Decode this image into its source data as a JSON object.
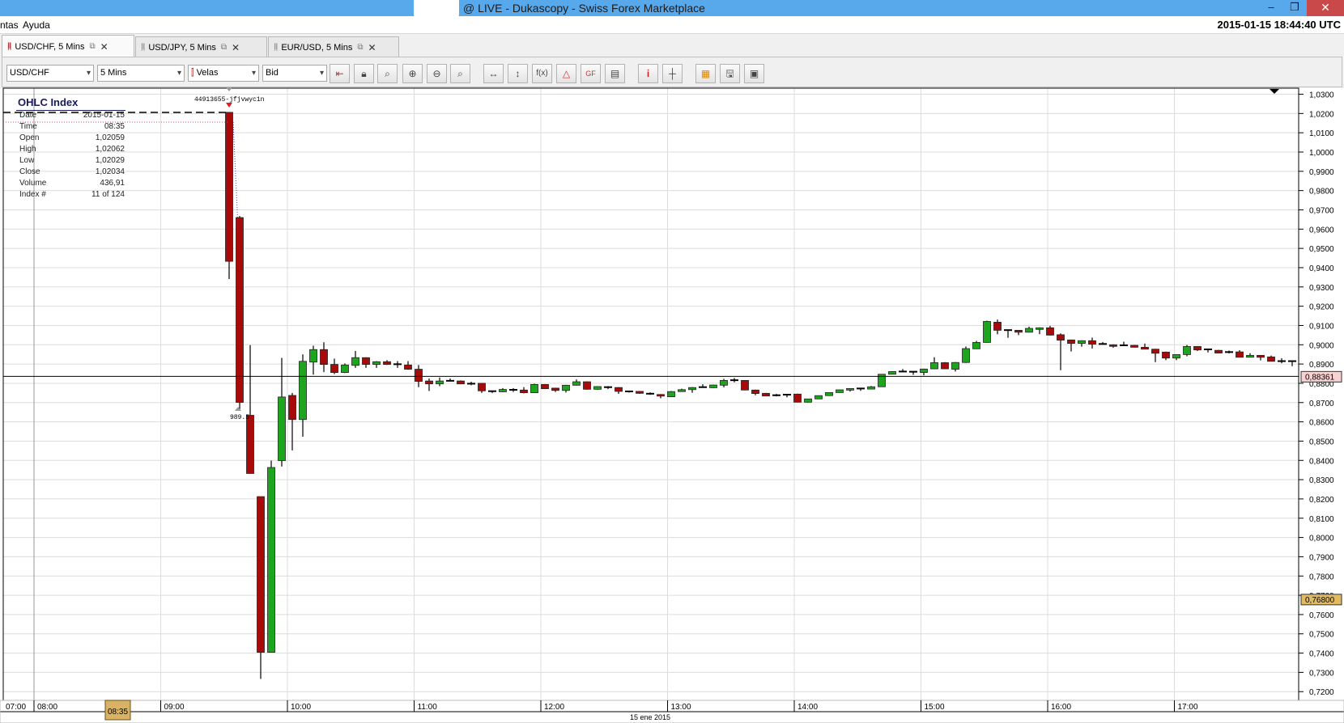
{
  "window": {
    "title": "@ LIVE - Dukascopy - Swiss Forex Marketplace",
    "minimize": "–",
    "restore": "❐",
    "close": "✕"
  },
  "menu": {
    "items": [
      "ntas",
      "Ayuda"
    ],
    "clock": "2015-01-15 18:44:40 UTC"
  },
  "tabs": [
    {
      "label": "USD/CHF,  5 Mins",
      "active": true
    },
    {
      "label": "USD/JPY,  5 Mins",
      "active": false
    },
    {
      "label": "EUR/USD,  5 Mins",
      "active": false
    }
  ],
  "toolbar": {
    "instrument": "USD/CHF",
    "period": "5 Mins",
    "chart_type": "Velas",
    "side": "Bid",
    "buttons": [
      "chart-type",
      "lock",
      "zoom-area",
      "zoom-in",
      "zoom-out",
      "zoom-reset",
      "fit-horizontal",
      "fit-vertical",
      "indicators",
      "drawings",
      "gann-fibo",
      "list",
      "info",
      "cursor",
      "colors",
      "save",
      "template"
    ]
  },
  "ohlc": {
    "title": "OHLC Index",
    "rows": [
      {
        "label": "Date",
        "value": "2015-01-15"
      },
      {
        "label": "Time",
        "value": "08:35"
      },
      {
        "label": "Open",
        "value": "1,02059"
      },
      {
        "label": "High",
        "value": "1,02062"
      },
      {
        "label": "Low",
        "value": "1,02029"
      },
      {
        "label": "Close",
        "value": "1,02034"
      },
      {
        "label": "Volume",
        "value": "436,91"
      },
      {
        "label": "Index #",
        "value": "11 of 124"
      }
    ]
  },
  "chart_data": {
    "type": "candlestick",
    "instrument": "USD/CHF",
    "ylim": [
      0.715,
      1.0325
    ],
    "y_ticks": [
      1.03,
      1.02,
      1.01,
      1.0,
      0.99,
      0.98,
      0.97,
      0.96,
      0.95,
      0.94,
      0.93,
      0.92,
      0.91,
      0.9,
      0.89,
      0.88,
      0.87,
      0.86,
      0.85,
      0.84,
      0.83,
      0.82,
      0.81,
      0.8,
      0.79,
      0.78,
      0.77,
      0.76,
      0.75,
      0.74,
      0.73,
      0.72
    ],
    "x_first_label": "07:00",
    "x_hour_labels": [
      "08:00",
      "09:00",
      "10:00",
      "11:00",
      "12:00",
      "13:00",
      "14:00",
      "15:00",
      "16:00",
      "17:00"
    ],
    "x_date_label": "15 ene 2015",
    "cursor_time": "08:35",
    "current_price": 0.88361,
    "current_price_label": "0,88361",
    "marker_price_label": "0,76800",
    "marker_price": 0.768,
    "order_label": "44913655-jfjvwyc1n",
    "low_label": "989.5",
    "colors": {
      "up": "#1ea51e",
      "down": "#a80a0a",
      "current_box": "#f8d2d2",
      "marker_box": "#e2ba62",
      "cursor_box": "#d9b363"
    },
    "candles_ohlc": [
      [
        1.0206,
        1.0206,
        0.9341,
        0.9433
      ],
      [
        0.966,
        0.9668,
        0.8665,
        0.8701
      ],
      [
        0.8634,
        0.8998,
        0.8332,
        0.8332
      ],
      [
        0.8212,
        0.8212,
        0.7266,
        0.7404
      ],
      [
        0.7404,
        0.8399,
        0.7404,
        0.8363
      ],
      [
        0.8399,
        0.8932,
        0.8368,
        0.8729
      ],
      [
        0.8737,
        0.875,
        0.8452,
        0.8612
      ],
      [
        0.8612,
        0.895,
        0.8523,
        0.8914
      ],
      [
        0.891,
        0.8995,
        0.8845,
        0.8975
      ],
      [
        0.8975,
        0.9013,
        0.8858,
        0.8898
      ],
      [
        0.8898,
        0.8928,
        0.8848,
        0.8856
      ],
      [
        0.8856,
        0.8903,
        0.8853,
        0.8895
      ],
      [
        0.8893,
        0.8968,
        0.888,
        0.8933
      ],
      [
        0.8933,
        0.8935,
        0.888,
        0.8898
      ],
      [
        0.8898,
        0.8915,
        0.888,
        0.8912
      ],
      [
        0.8912,
        0.892,
        0.8895,
        0.8898
      ],
      [
        0.8898,
        0.8915,
        0.888,
        0.8899
      ],
      [
        0.8895,
        0.8915,
        0.887,
        0.8873
      ],
      [
        0.8873,
        0.8895,
        0.878,
        0.881
      ],
      [
        0.8812,
        0.8825,
        0.876,
        0.8797
      ],
      [
        0.8797,
        0.883,
        0.8785,
        0.8812
      ],
      [
        0.8812,
        0.8825,
        0.881,
        0.8813
      ],
      [
        0.8812,
        0.8815,
        0.8795,
        0.8797
      ],
      [
        0.8797,
        0.8808,
        0.879,
        0.8798
      ],
      [
        0.88,
        0.8802,
        0.875,
        0.8761
      ],
      [
        0.8758,
        0.8762,
        0.875,
        0.8759
      ],
      [
        0.8756,
        0.8775,
        0.8754,
        0.8768
      ],
      [
        0.8765,
        0.8775,
        0.8755,
        0.8766
      ],
      [
        0.8765,
        0.878,
        0.8748,
        0.8751
      ],
      [
        0.8751,
        0.8798,
        0.875,
        0.8794
      ],
      [
        0.8794,
        0.8796,
        0.877,
        0.8772
      ],
      [
        0.8775,
        0.8777,
        0.8755,
        0.8763
      ],
      [
        0.8763,
        0.8792,
        0.8752,
        0.879
      ],
      [
        0.879,
        0.882,
        0.8788,
        0.8808
      ],
      [
        0.8808,
        0.881,
        0.8767,
        0.8769
      ],
      [
        0.8769,
        0.8785,
        0.8767,
        0.8783
      ],
      [
        0.8779,
        0.8785,
        0.877,
        0.878
      ],
      [
        0.8778,
        0.878,
        0.8745,
        0.8758
      ],
      [
        0.8759,
        0.8762,
        0.8752,
        0.8758
      ],
      [
        0.8758,
        0.876,
        0.8745,
        0.8748
      ],
      [
        0.8747,
        0.8753,
        0.874,
        0.8746
      ],
      [
        0.8742,
        0.8744,
        0.8722,
        0.8734
      ],
      [
        0.873,
        0.876,
        0.8729,
        0.8757
      ],
      [
        0.8757,
        0.8772,
        0.8756,
        0.8767
      ],
      [
        0.8767,
        0.878,
        0.8751,
        0.8778
      ],
      [
        0.8779,
        0.8795,
        0.8778,
        0.878
      ],
      [
        0.8777,
        0.8793,
        0.8776,
        0.8791
      ],
      [
        0.879,
        0.8823,
        0.8779,
        0.8815
      ],
      [
        0.8815,
        0.8828,
        0.8805,
        0.8816
      ],
      [
        0.8815,
        0.8817,
        0.8764,
        0.8765
      ],
      [
        0.8765,
        0.8767,
        0.8738,
        0.8747
      ],
      [
        0.8748,
        0.875,
        0.8733,
        0.8734
      ],
      [
        0.8737,
        0.8745,
        0.8732,
        0.8738
      ],
      [
        0.8742,
        0.8744,
        0.8727,
        0.8741
      ],
      [
        0.8744,
        0.8746,
        0.8701,
        0.8702
      ],
      [
        0.8702,
        0.872,
        0.87,
        0.8719
      ],
      [
        0.8719,
        0.8737,
        0.8718,
        0.8736
      ],
      [
        0.8736,
        0.8753,
        0.8735,
        0.8752
      ],
      [
        0.8752,
        0.8767,
        0.8751,
        0.8766
      ],
      [
        0.8765,
        0.8775,
        0.8757,
        0.8773
      ],
      [
        0.8772,
        0.8774,
        0.8761,
        0.8773
      ],
      [
        0.877,
        0.8786,
        0.8769,
        0.8782
      ],
      [
        0.8782,
        0.8848,
        0.8781,
        0.8847
      ],
      [
        0.8847,
        0.8862,
        0.8846,
        0.8861
      ],
      [
        0.886,
        0.8874,
        0.8859,
        0.8861
      ],
      [
        0.8859,
        0.8862,
        0.8844,
        0.886
      ],
      [
        0.8856,
        0.8876,
        0.8841,
        0.8874
      ],
      [
        0.8875,
        0.8935,
        0.8873,
        0.8907
      ],
      [
        0.8907,
        0.891,
        0.8874,
        0.8875
      ],
      [
        0.8873,
        0.891,
        0.8861,
        0.8908
      ],
      [
        0.8908,
        0.8991,
        0.8906,
        0.898
      ],
      [
        0.8979,
        0.902,
        0.8978,
        0.9012
      ],
      [
        0.9012,
        0.9125,
        0.9011,
        0.9121
      ],
      [
        0.9117,
        0.9131,
        0.9054,
        0.9075
      ],
      [
        0.9075,
        0.9077,
        0.9036,
        0.9076
      ],
      [
        0.9075,
        0.9077,
        0.905,
        0.9065
      ],
      [
        0.9065,
        0.9094,
        0.9064,
        0.9085
      ],
      [
        0.908,
        0.909,
        0.9055,
        0.9088
      ],
      [
        0.9088,
        0.9098,
        0.9048,
        0.905
      ],
      [
        0.9052,
        0.9059,
        0.8868,
        0.9024
      ],
      [
        0.9025,
        0.9027,
        0.8965,
        0.9007
      ],
      [
        0.9007,
        0.9023,
        0.899,
        0.9021
      ],
      [
        0.9021,
        0.9037,
        0.898,
        0.9003
      ],
      [
        0.9003,
        0.9014,
        0.9002,
        0.9004
      ],
      [
        0.9,
        0.9002,
        0.8985,
        0.8996
      ],
      [
        0.8996,
        0.9016,
        0.8995,
        0.8997
      ],
      [
        0.8997,
        0.8999,
        0.8986,
        0.8987
      ],
      [
        0.8987,
        0.9006,
        0.8976,
        0.8977
      ],
      [
        0.8977,
        0.8979,
        0.891,
        0.8956
      ],
      [
        0.8962,
        0.8964,
        0.892,
        0.8931
      ],
      [
        0.8931,
        0.895,
        0.892,
        0.8949
      ],
      [
        0.8949,
        0.8999,
        0.894,
        0.8991
      ],
      [
        0.8991,
        0.8993,
        0.8968,
        0.8973
      ],
      [
        0.8975,
        0.8977,
        0.896,
        0.8976
      ],
      [
        0.8971,
        0.8973,
        0.8956,
        0.8957
      ],
      [
        0.8961,
        0.897,
        0.8955,
        0.8962
      ],
      [
        0.8963,
        0.8972,
        0.8934,
        0.8935
      ],
      [
        0.8935,
        0.8956,
        0.8934,
        0.8945
      ],
      [
        0.8945,
        0.8947,
        0.8919,
        0.8935
      ],
      [
        0.8937,
        0.8944,
        0.8913,
        0.8914
      ],
      [
        0.8914,
        0.893,
        0.8904,
        0.8915
      ],
      [
        0.8914,
        0.8916,
        0.8889,
        0.8915
      ]
    ]
  }
}
